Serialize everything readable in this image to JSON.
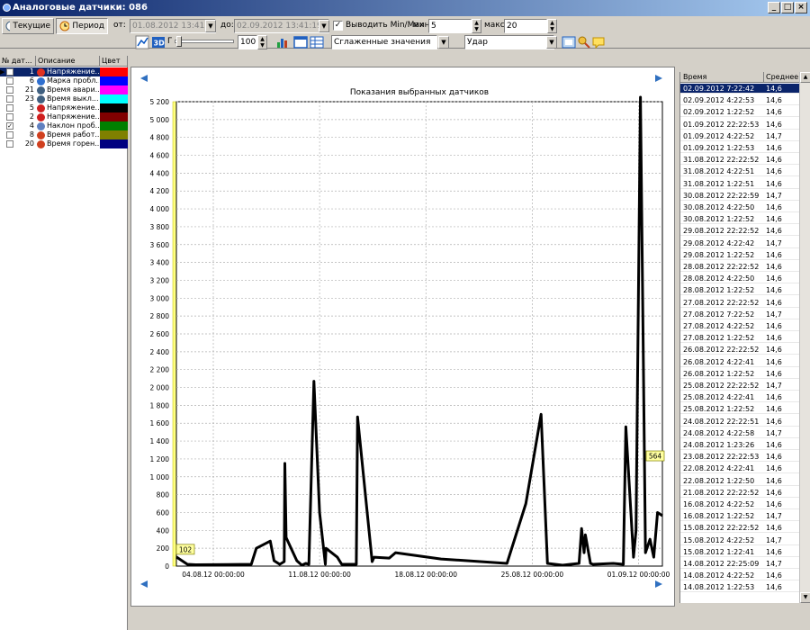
{
  "window": {
    "title": "Аналоговые датчики: 086"
  },
  "toolbar": {
    "current_label": "Текущие",
    "period_label": "Период",
    "from_label": "от:",
    "from_value": "01.08.2012 13:41:19",
    "to_label": "до:",
    "to_value": "02.09.2012 13:41:19",
    "minmax_label": "Выводить Min/Max",
    "min_label": "мин:",
    "min_value": "5",
    "max_label": "макс:",
    "max_value": "20",
    "t_label": "Г",
    "zoom_value": "100",
    "smooth_value": "Сглаженные значения",
    "event_value": "Удар"
  },
  "sensors": {
    "headers": {
      "num": "№ дат...",
      "desc": "Описание",
      "color": "Цвет"
    },
    "rows": [
      {
        "num": "1",
        "desc": "Напряжение...",
        "color": "#ff0000",
        "icon": "voltage-icon",
        "iconColor": "#e03020",
        "checked": false,
        "current": true
      },
      {
        "num": "6",
        "desc": "Марка пробл...",
        "color": "#0000ff",
        "icon": "globe-icon",
        "iconColor": "#3070d0",
        "checked": false,
        "current": false
      },
      {
        "num": "21",
        "desc": "Время авари...",
        "color": "#ff00ff",
        "icon": "clock-icon",
        "iconColor": "#406080",
        "checked": false,
        "current": false
      },
      {
        "num": "23",
        "desc": "Время выкл...",
        "color": "#00ffff",
        "icon": "clock-icon",
        "iconColor": "#406080",
        "checked": false,
        "current": false
      },
      {
        "num": "5",
        "desc": "Напряжение...",
        "color": "#000000",
        "icon": "battery-icon",
        "iconColor": "#d02020",
        "checked": false,
        "current": false
      },
      {
        "num": "2",
        "desc": "Напряжение...",
        "color": "#800000",
        "icon": "battery-icon",
        "iconColor": "#d02020",
        "checked": false,
        "current": false
      },
      {
        "num": "4",
        "desc": "Наклон проб...",
        "color": "#008000",
        "icon": "tilt-icon",
        "iconColor": "#6080c0",
        "checked": true,
        "current": false
      },
      {
        "num": "8",
        "desc": "Время работ...",
        "color": "#808000",
        "icon": "timer-icon",
        "iconColor": "#d04020",
        "checked": false,
        "current": false
      },
      {
        "num": "20",
        "desc": "Время горен...",
        "color": "#000080",
        "icon": "timer-icon",
        "iconColor": "#d04020",
        "checked": false,
        "current": false
      }
    ]
  },
  "chart_data": {
    "type": "line",
    "title": "Показания выбранных датчиков",
    "xlabel": "",
    "ylabel": "",
    "x_ticks": [
      "04.08.12 00:00:00",
      "11.08.12 00:00:00",
      "18.08.12 00:00:00",
      "25.08.12 00:00:00",
      "01.09.12 00:00:00"
    ],
    "y_ticks": [
      "5 200",
      "5 000",
      "4 800",
      "4 600",
      "4 400",
      "4 200",
      "4 000",
      "3 800",
      "3 600",
      "3 400",
      "3 200",
      "3 000",
      "2 800",
      "2 600",
      "2 400",
      "2 200",
      "2 000",
      "1 800",
      "1 600",
      "1 400",
      "1 200",
      "1 000",
      "800",
      "600",
      "400",
      "200",
      "0"
    ],
    "ylim": [
      0,
      5200
    ],
    "xlim": [
      "01.08.2012 13:41",
      "02.09.2012 13:41"
    ],
    "grid": true,
    "labels": {
      "start_value": "102",
      "end_value": "564"
    },
    "series": [
      {
        "color": "#000000",
        "points": [
          [
            "01.08.2012 13:41",
            102
          ],
          [
            "02.08.2012 07:00",
            20
          ],
          [
            "02.08.2012 20:00",
            15
          ],
          [
            "06.08.2012 12:00",
            20
          ],
          [
            "06.08.2012 20:00",
            200
          ],
          [
            "07.08.2012 18:00",
            280
          ],
          [
            "08.08.2012 00:00",
            60
          ],
          [
            "08.08.2012 09:00",
            20
          ],
          [
            "08.08.2012 16:00",
            50
          ],
          [
            "08.08.2012 17:00",
            1150
          ],
          [
            "08.08.2012 19:00",
            320
          ],
          [
            "09.08.2012 12:00",
            60
          ],
          [
            "09.08.2012 20:00",
            10
          ],
          [
            "10.08.2012 02:00",
            30
          ],
          [
            "10.08.2012 07:00",
            20
          ],
          [
            "10.08.2012 15:00",
            2070
          ],
          [
            "11.08.2012 00:00",
            600
          ],
          [
            "11.08.2012 09:00",
            20
          ],
          [
            "11.08.2012 10:00",
            200
          ],
          [
            "12.08.2012 04:00",
            100
          ],
          [
            "12.08.2012 11:00",
            20
          ],
          [
            "13.08.2012 10:00",
            20
          ],
          [
            "13.08.2012 12:00",
            1670
          ],
          [
            "14.08.2012 11:00",
            50
          ],
          [
            "14.08.2012 14:00",
            100
          ],
          [
            "15.08.2012 14:00",
            90
          ],
          [
            "16.08.2012 00:00",
            150
          ],
          [
            "19.08.2012 00:00",
            80
          ],
          [
            "23.08.2012 08:00",
            30
          ],
          [
            "24.08.2012 14:00",
            700
          ],
          [
            "25.08.2012 14:00",
            1700
          ],
          [
            "26.08.2012 00:00",
            30
          ],
          [
            "27.08.2012 00:00",
            10
          ],
          [
            "28.08.2012 02:00",
            30
          ],
          [
            "28.08.2012 06:00",
            420
          ],
          [
            "28.08.2012 10:00",
            150
          ],
          [
            "28.08.2012 12:00",
            350
          ],
          [
            "28.08.2012 20:00",
            30
          ],
          [
            "29.08.2012 00:00",
            20
          ],
          [
            "30.08.2012 08:00",
            30
          ],
          [
            "31.08.2012 00:00",
            20
          ],
          [
            "31.08.2012 04:00",
            1560
          ],
          [
            "31.08.2012 16:00",
            100
          ],
          [
            "31.08.2012 20:00",
            400
          ],
          [
            "01.09.2012 03:00",
            5250
          ],
          [
            "01.09.2012 11:00",
            150
          ],
          [
            "01.09.2012 18:00",
            300
          ],
          [
            "02.09.2012 00:00",
            100
          ],
          [
            "02.09.2012 06:00",
            600
          ],
          [
            "02.09.2012 13:41",
            564
          ]
        ]
      }
    ]
  },
  "readings": {
    "headers": {
      "time": "Время",
      "avg": "Среднее"
    },
    "rows": [
      [
        "02.09.2012 7:22:42",
        "14,6"
      ],
      [
        "02.09.2012 4:22:53",
        "14,6"
      ],
      [
        "02.09.2012 1:22:52",
        "14,6"
      ],
      [
        "01.09.2012 22:22:53",
        "14,6"
      ],
      [
        "01.09.2012 4:22:52",
        "14,7"
      ],
      [
        "01.09.2012 1:22:53",
        "14,6"
      ],
      [
        "31.08.2012 22:22:52",
        "14,6"
      ],
      [
        "31.08.2012 4:22:51",
        "14,6"
      ],
      [
        "31.08.2012 1:22:51",
        "14,6"
      ],
      [
        "30.08.2012 22:22:59",
        "14,7"
      ],
      [
        "30.08.2012 4:22:50",
        "14,6"
      ],
      [
        "30.08.2012 1:22:52",
        "14,6"
      ],
      [
        "29.08.2012 22:22:52",
        "14,6"
      ],
      [
        "29.08.2012 4:22:42",
        "14,7"
      ],
      [
        "29.08.2012 1:22:52",
        "14,6"
      ],
      [
        "28.08.2012 22:22:52",
        "14,6"
      ],
      [
        "28.08.2012 4:22:50",
        "14,6"
      ],
      [
        "28.08.2012 1:22:52",
        "14,6"
      ],
      [
        "27.08.2012 22:22:52",
        "14,6"
      ],
      [
        "27.08.2012 7:22:52",
        "14,7"
      ],
      [
        "27.08.2012 4:22:52",
        "14,6"
      ],
      [
        "27.08.2012 1:22:52",
        "14,6"
      ],
      [
        "26.08.2012 22:22:52",
        "14,6"
      ],
      [
        "26.08.2012 4:22:41",
        "14,6"
      ],
      [
        "26.08.2012 1:22:52",
        "14,6"
      ],
      [
        "25.08.2012 22:22:52",
        "14,7"
      ],
      [
        "25.08.2012 4:22:41",
        "14,6"
      ],
      [
        "25.08.2012 1:22:52",
        "14,6"
      ],
      [
        "24.08.2012 22:22:51",
        "14,6"
      ],
      [
        "24.08.2012 4:22:58",
        "14,7"
      ],
      [
        "24.08.2012 1:23:26",
        "14,6"
      ],
      [
        "23.08.2012 22:22:53",
        "14,6"
      ],
      [
        "22.08.2012 4:22:41",
        "14,6"
      ],
      [
        "22.08.2012 1:22:50",
        "14,6"
      ],
      [
        "21.08.2012 22:22:52",
        "14,6"
      ],
      [
        "16.08.2012 4:22:52",
        "14,6"
      ],
      [
        "16.08.2012 1:22:52",
        "14,7"
      ],
      [
        "15.08.2012 22:22:52",
        "14,6"
      ],
      [
        "15.08.2012 4:22:52",
        "14,7"
      ],
      [
        "15.08.2012 1:22:41",
        "14,6"
      ],
      [
        "14.08.2012 22:25:09",
        "14,7"
      ],
      [
        "14.08.2012 4:22:52",
        "14,6"
      ],
      [
        "14.08.2012 1:22:53",
        "14,6"
      ]
    ]
  }
}
